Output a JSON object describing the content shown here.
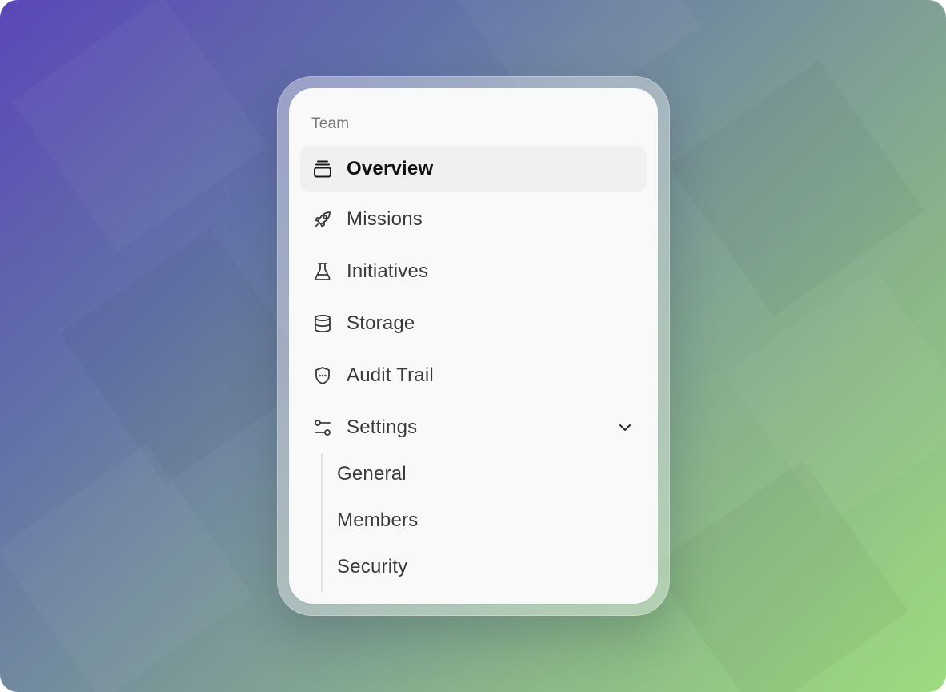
{
  "sidebar": {
    "section_label": "Team",
    "items": [
      {
        "label": "Overview",
        "icon": "stack-icon",
        "active": true
      },
      {
        "label": "Missions",
        "icon": "rocket-icon"
      },
      {
        "label": "Initiatives",
        "icon": "flask-icon"
      },
      {
        "label": "Storage",
        "icon": "database-icon"
      },
      {
        "label": "Audit Trail",
        "icon": "shield-icon"
      },
      {
        "label": "Settings",
        "icon": "sliders-icon",
        "expanded": true
      }
    ],
    "settings_subitems": [
      {
        "label": "General"
      },
      {
        "label": "Members"
      },
      {
        "label": "Security"
      }
    ]
  },
  "colors": {
    "active_bg": "#f0f0f0",
    "text": "#3a3a3a",
    "muted": "#7a7a7a",
    "card_bg": "#f9f9f9"
  }
}
